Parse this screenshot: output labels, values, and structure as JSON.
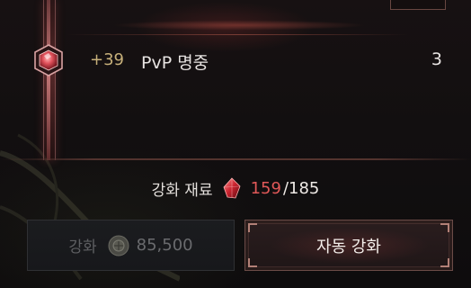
{
  "stat": {
    "bonus": "+39",
    "name": "PvP 명중",
    "value": "3"
  },
  "material": {
    "label": "강화 재료",
    "have": "159",
    "need": "/185",
    "icon": "red-crystal-icon"
  },
  "buttons": {
    "enhance": {
      "label": "강화",
      "cost": "85,500",
      "icon": "coin-icon",
      "state": "disabled"
    },
    "auto_enhance": {
      "label": "자동 강화"
    }
  },
  "colors": {
    "shortage_red": "#e05858",
    "bonus_gold": "#c7b07a",
    "accent_border": "#6b4b47"
  }
}
